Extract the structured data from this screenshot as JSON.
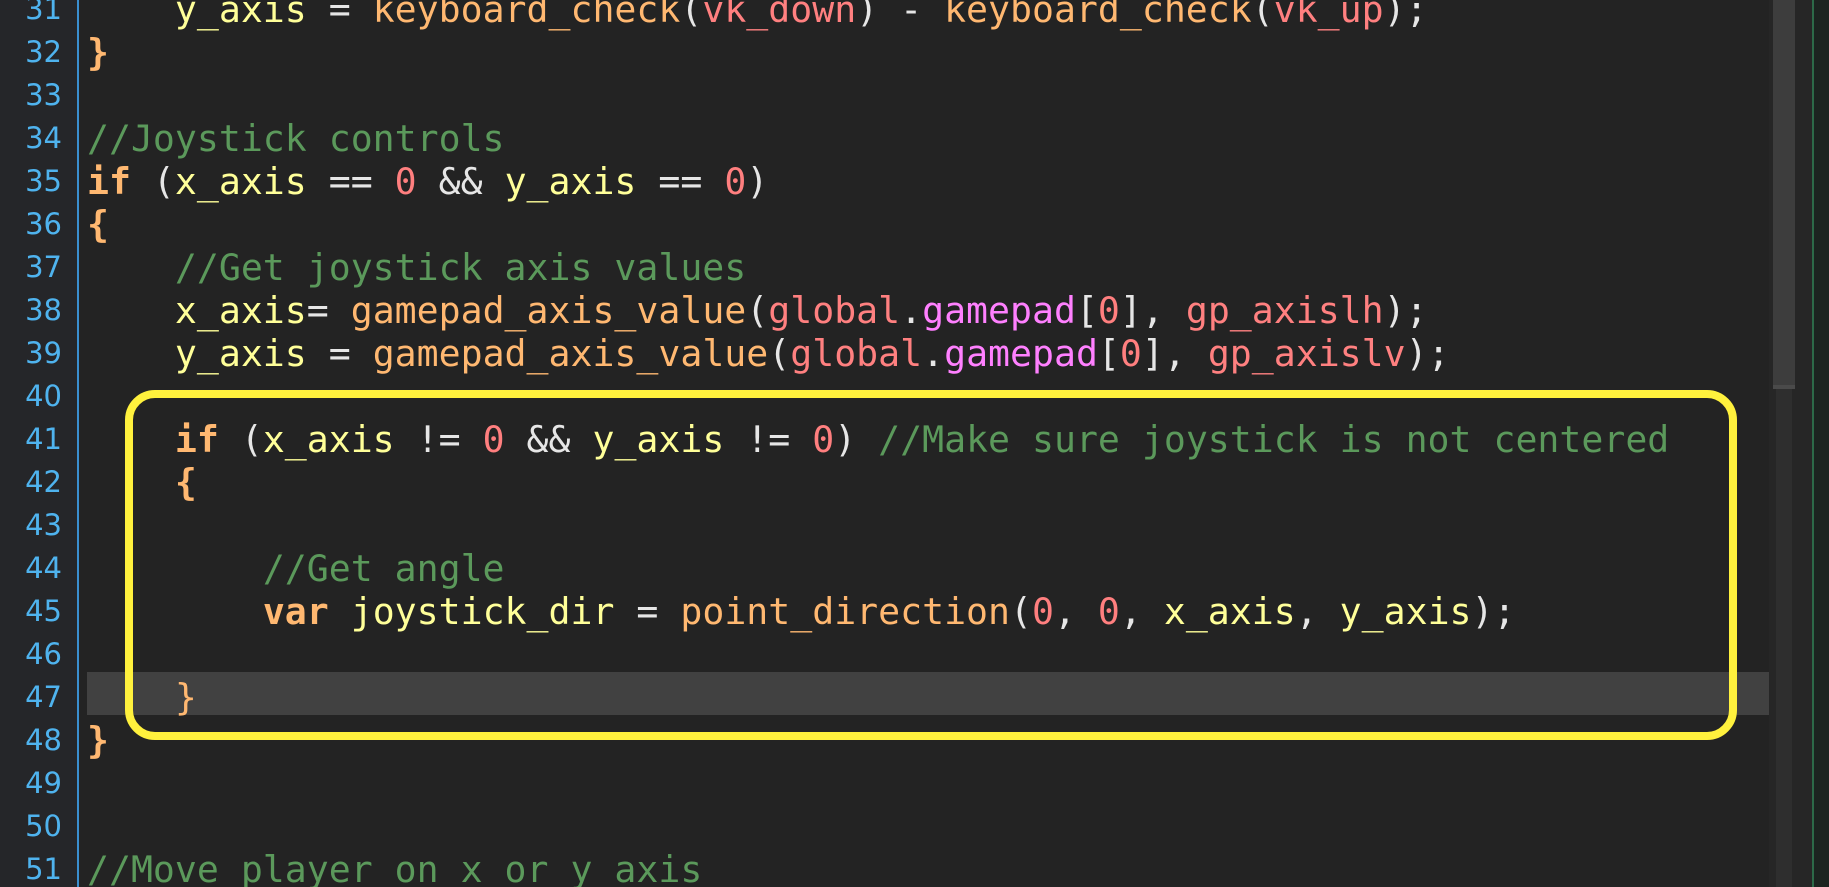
{
  "editor": {
    "line_numbers": [
      "31",
      "32",
      "33",
      "34",
      "35",
      "36",
      "37",
      "38",
      "39",
      "40",
      "41",
      "42",
      "43",
      "44",
      "45",
      "46",
      "47",
      "48",
      "49",
      "50",
      "51"
    ],
    "current_line": "47",
    "lines": {
      "l31": {
        "indent": "    ",
        "var1": "y_axis",
        "op1": " = ",
        "fn1": "keyboard_check",
        "p1": "(",
        "c1": "vk_down",
        "p2": ") - ",
        "fn2": "keyboard_check",
        "p3": "(",
        "c2": "vk_up",
        "p4": ");"
      },
      "l32": {
        "brace": "}"
      },
      "l34": {
        "comment": "//Joystick controls"
      },
      "l35": {
        "kw": "if",
        "p1": " (",
        "var1": "x_axis",
        "op1": " == ",
        "num1": "0",
        "op2": " && ",
        "var2": "y_axis",
        "op3": " == ",
        "num2": "0",
        "p2": ")"
      },
      "l36": {
        "brace": "{"
      },
      "l37": {
        "indent": "    ",
        "comment": "//Get joystick axis values"
      },
      "l38": {
        "indent": "    ",
        "var1": "x_axis",
        "op1": "= ",
        "fn": "gamepad_axis_value",
        "p1": "(",
        "glob": "global",
        "dot": ".",
        "field": "gamepad",
        "p2": "[",
        "num": "0",
        "p3": "], ",
        "const": "gp_axislh",
        "p4": ");"
      },
      "l39": {
        "indent": "    ",
        "var1": "y_axis",
        "op1": " = ",
        "fn": "gamepad_axis_value",
        "p1": "(",
        "glob": "global",
        "dot": ".",
        "field": "gamepad",
        "p2": "[",
        "num": "0",
        "p3": "], ",
        "const": "gp_axislv",
        "p4": ");"
      },
      "l41": {
        "indent": "    ",
        "kw": "if",
        "p1": " (",
        "var1": "x_axis",
        "op1": " != ",
        "num1": "0",
        "op2": " && ",
        "var2": "y_axis",
        "op3": " != ",
        "num2": "0",
        "p2": ") ",
        "comment": "//Make sure joystick is not centered"
      },
      "l42": {
        "indent": "    ",
        "brace": "{"
      },
      "l44": {
        "indent": "        ",
        "comment": "//Get angle"
      },
      "l45": {
        "indent": "        ",
        "kw": "var",
        "sp": " ",
        "var1": "joystick_dir",
        "op1": " = ",
        "fn": "point_direction",
        "p1": "(",
        "num1": "0",
        "p2": ", ",
        "num2": "0",
        "p3": ", ",
        "var2": "x_axis",
        "p4": ", ",
        "var3": "y_axis",
        "p5": ");"
      },
      "l47": {
        "indent": "    ",
        "brace": "}"
      },
      "l48": {
        "brace": "}"
      },
      "l51": {
        "comment": "//Move player on x or y axis"
      }
    }
  },
  "colors": {
    "background": "#232323",
    "line_number": "#4fb3ee",
    "keyword": "#ffb871",
    "variable": "#ffff99",
    "number": "#ff7f7f",
    "comment": "#5b995b",
    "highlight_box": "#fff13d"
  }
}
